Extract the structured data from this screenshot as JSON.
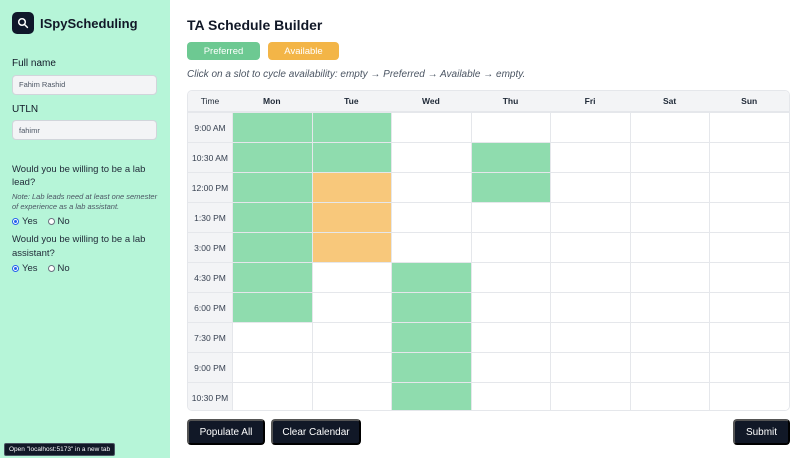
{
  "sidebar": {
    "brand": "ISpyScheduling",
    "full_name_label": "Full name",
    "full_name_value": "Fahim Rashid",
    "utln_label": "UTLN",
    "utln_value": "fahimr",
    "lab_lead_question": "Would you be willing to be a lab lead?",
    "lab_lead_note": "Note: Lab leads need at least one semester of experience as a lab assistant.",
    "lab_lead_answer": "Yes",
    "lab_assistant_question": "Would you be willing to be a lab assistant?",
    "lab_assistant_answer": "Yes",
    "yes_label": "Yes",
    "no_label": "No"
  },
  "status_tip": "Open \"localhost:5173\" in a new tab",
  "main": {
    "title": "TA Schedule Builder",
    "legend": {
      "preferred": "Preferred",
      "available": "Available"
    },
    "instruction": "Click on a slot to cycle availability: empty → Preferred → Available → empty.",
    "preferred_color": "#8fdcae",
    "available_color": "#f8c87b"
  },
  "schedule": {
    "time_header": "Time",
    "days": [
      "Mon",
      "Tue",
      "Wed",
      "Thu",
      "Fri",
      "Sat",
      "Sun"
    ],
    "times": [
      "9:00 AM",
      "10:30 AM",
      "12:00 PM",
      "1:30 PM",
      "3:00 PM",
      "4:30 PM",
      "6:00 PM",
      "7:30 PM",
      "9:00 PM",
      "10:30 PM"
    ],
    "slots": [
      [
        "preferred",
        "preferred",
        "empty",
        "empty",
        "empty",
        "empty",
        "empty"
      ],
      [
        "preferred",
        "preferred",
        "empty",
        "preferred",
        "empty",
        "empty",
        "empty"
      ],
      [
        "preferred",
        "available",
        "empty",
        "preferred",
        "empty",
        "empty",
        "empty"
      ],
      [
        "preferred",
        "available",
        "empty",
        "empty",
        "empty",
        "empty",
        "empty"
      ],
      [
        "preferred",
        "available",
        "empty",
        "empty",
        "empty",
        "empty",
        "empty"
      ],
      [
        "preferred",
        "empty",
        "preferred",
        "empty",
        "empty",
        "empty",
        "empty"
      ],
      [
        "preferred",
        "empty",
        "preferred",
        "empty",
        "empty",
        "empty",
        "empty"
      ],
      [
        "empty",
        "empty",
        "preferred",
        "empty",
        "empty",
        "empty",
        "empty"
      ],
      [
        "empty",
        "empty",
        "preferred",
        "empty",
        "empty",
        "empty",
        "empty"
      ],
      [
        "empty",
        "empty",
        "preferred",
        "empty",
        "empty",
        "empty",
        "empty"
      ]
    ]
  },
  "buttons": {
    "populate_all": "Populate All",
    "clear_calendar": "Clear Calendar",
    "submit": "Submit"
  }
}
